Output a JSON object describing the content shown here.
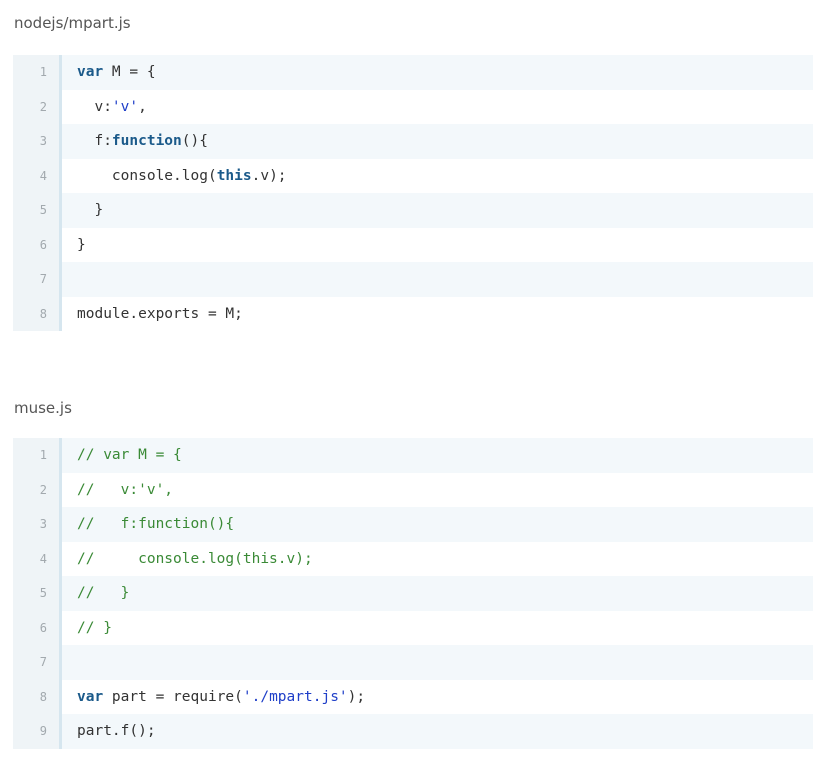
{
  "blocks": [
    {
      "title": "nodejs/mpart.js",
      "lines": [
        [
          {
            "t": "var",
            "c": "kw"
          },
          {
            "t": " M = {",
            "c": "pl"
          }
        ],
        [
          {
            "t": "  v:",
            "c": "pl"
          },
          {
            "t": "'v'",
            "c": "str"
          },
          {
            "t": ",",
            "c": "pl"
          }
        ],
        [
          {
            "t": "  f:",
            "c": "pl"
          },
          {
            "t": "function",
            "c": "kw"
          },
          {
            "t": "(){",
            "c": "pl"
          }
        ],
        [
          {
            "t": "    console.log(",
            "c": "pl"
          },
          {
            "t": "this",
            "c": "kw"
          },
          {
            "t": ".v);",
            "c": "pl"
          }
        ],
        [
          {
            "t": "  }",
            "c": "pl"
          }
        ],
        [
          {
            "t": "}",
            "c": "pl"
          }
        ],
        [],
        [
          {
            "t": "module.exports = M;",
            "c": "pl"
          }
        ]
      ]
    },
    {
      "title": "muse.js",
      "lines": [
        [
          {
            "t": "// var M = {",
            "c": "cmt"
          }
        ],
        [
          {
            "t": "//   v:'v',",
            "c": "cmt"
          }
        ],
        [
          {
            "t": "//   f:function(){",
            "c": "cmt"
          }
        ],
        [
          {
            "t": "//     console.log(this.v);",
            "c": "cmt"
          }
        ],
        [
          {
            "t": "//   }",
            "c": "cmt"
          }
        ],
        [
          {
            "t": "// }",
            "c": "cmt"
          }
        ],
        [],
        [
          {
            "t": "var",
            "c": "kw"
          },
          {
            "t": " part = require(",
            "c": "pl"
          },
          {
            "t": "'./mpart.js'",
            "c": "str"
          },
          {
            "t": ");",
            "c": "pl"
          }
        ],
        [
          {
            "t": "part.f();",
            "c": "pl"
          }
        ]
      ]
    }
  ]
}
